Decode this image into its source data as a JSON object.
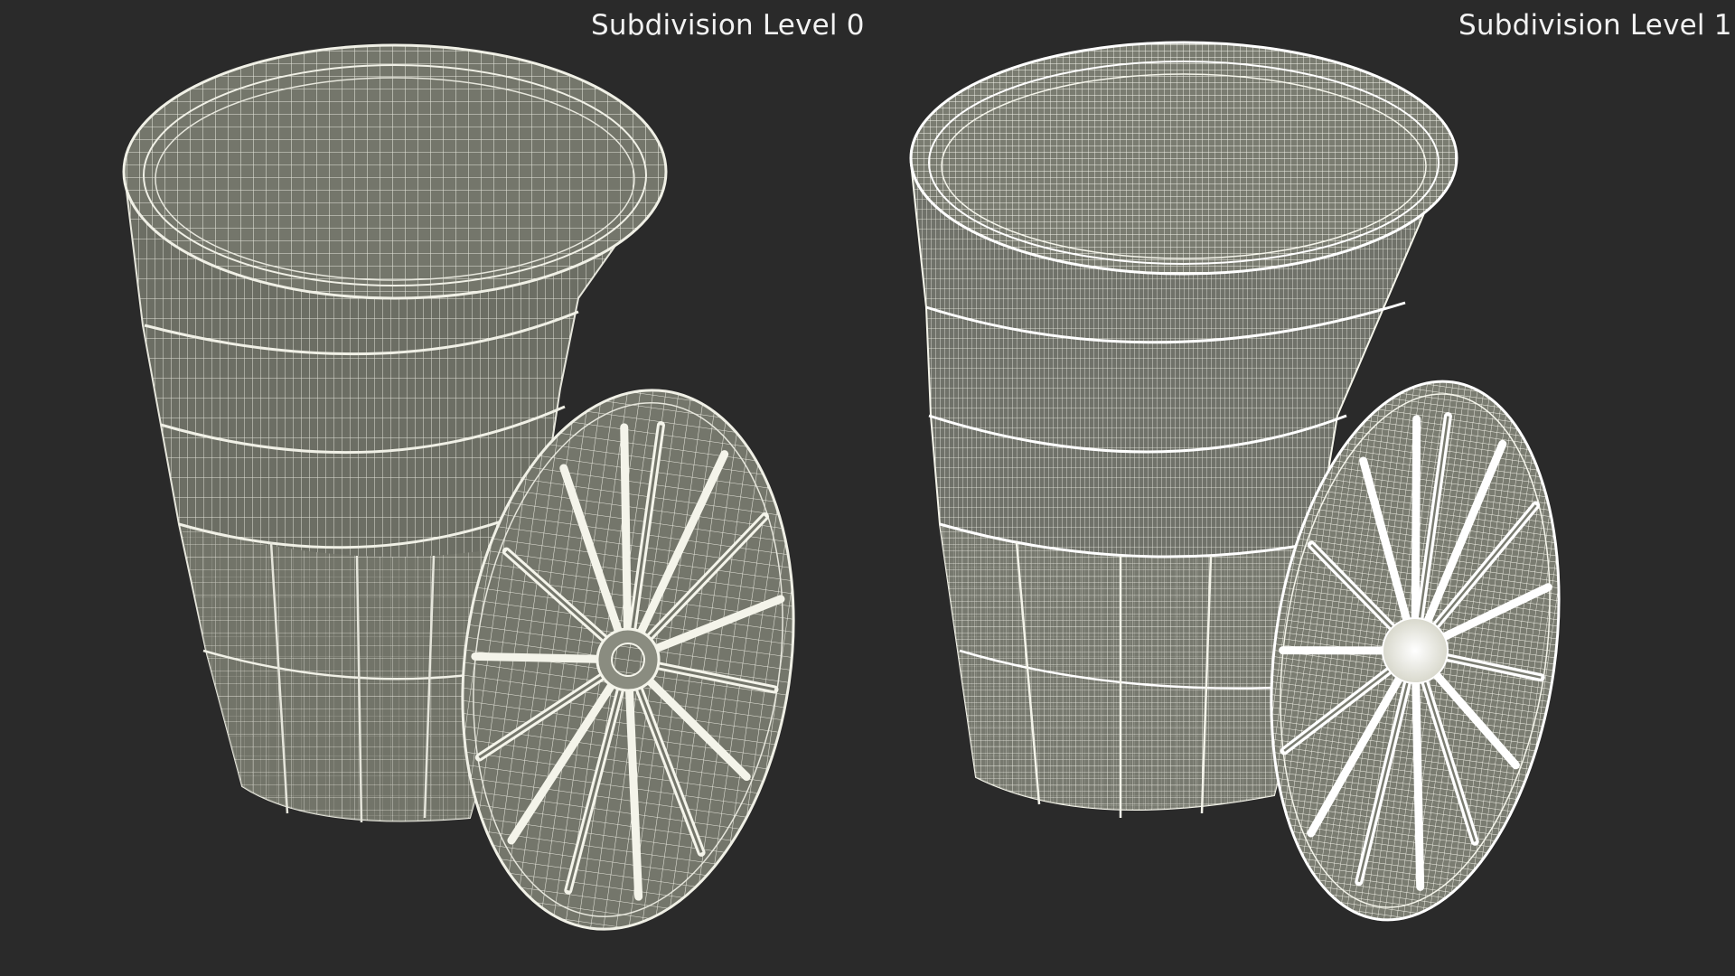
{
  "captions": {
    "left": "Subdivision Level 0",
    "right": "Subdivision Level 1"
  },
  "colors": {
    "background": "#2a2a2a",
    "surface": "#74766b",
    "surface_dark": "#5e6057",
    "wire_level0": "#e6e6dc",
    "wire_level1": "#f4f4ea",
    "caption_text": "#f2f2f2"
  },
  "models": [
    {
      "name": "barrel-with-lid",
      "subdivision_level": 0
    },
    {
      "name": "barrel-with-lid",
      "subdivision_level": 1
    }
  ]
}
